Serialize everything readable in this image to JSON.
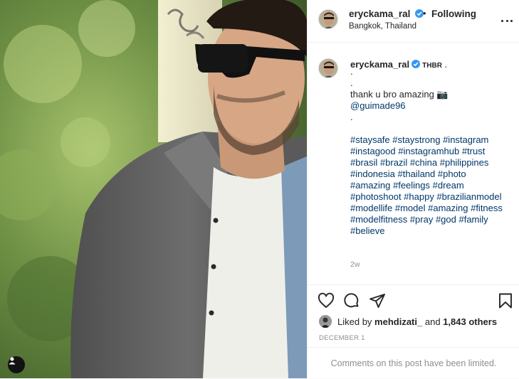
{
  "header": {
    "username": "eryckama_ral",
    "separator": "•",
    "follow_label": "Following",
    "location": "Bangkok, Thailand"
  },
  "caption": {
    "username": "eryckama_ral",
    "flag": "THBR",
    "flag_suffix": " .",
    "lines": [
      ".",
      ".",
      "thank u bro amazing 📷",
      "@guimade96",
      ".",
      "",
      "#staysafe #staystrong #instagram",
      "#instagood #instagramhub #trust",
      "#brasil #brazil #china #philippines",
      "#indonesia #thailand #photo",
      "#amazing #feelings #dream",
      "#photoshoot #happy #brazilianmodel",
      "#modellife #model #amazing #fitness",
      "#modelfitness #pray #god #family",
      "#believe"
    ],
    "time": "2w"
  },
  "actions": {
    "icons": [
      "heart-icon",
      "comment-icon",
      "share-icon",
      "bookmark-icon"
    ]
  },
  "likes": {
    "prefix": "Liked by",
    "user": "mehdizati_",
    "mid": "and",
    "count": "1,843 others"
  },
  "date": "DECEMBER 1",
  "comments_note": "Comments on this post have been limited.",
  "colors": {
    "text": "#262626",
    "link": "#00376b",
    "muted": "#8e8e8e",
    "verified": "#3897f0",
    "border": "#efefef"
  }
}
